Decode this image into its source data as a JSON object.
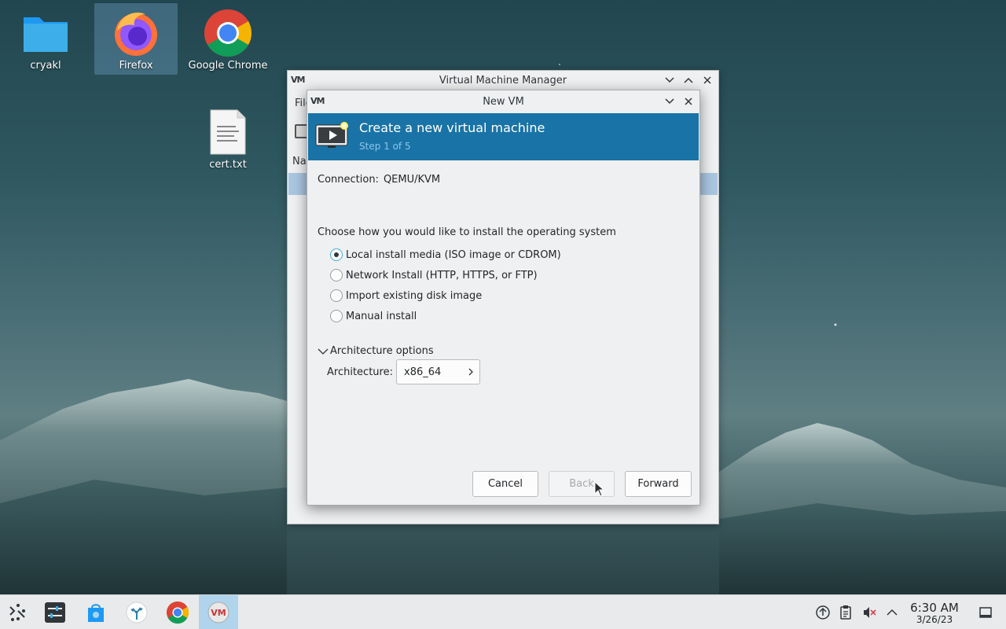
{
  "desktop": {
    "icons": [
      {
        "label": "cryakl"
      },
      {
        "label": "Firefox"
      },
      {
        "label": "Google Chrome"
      },
      {
        "label": "cert.txt"
      }
    ]
  },
  "vmm_window": {
    "logo": "VM",
    "title": "Virtual Machine Manager",
    "menu_partial": "File",
    "column_partial": "Name"
  },
  "dialog": {
    "logo": "VM",
    "title": "New VM",
    "banner_title": "Create a new virtual machine",
    "banner_step": "Step 1 of 5",
    "connection_label": "Connection:",
    "connection_value": "QEMU/KVM",
    "choose_label": "Choose how you would like to install the operating system",
    "options": [
      {
        "label": "Local install media (ISO image or CDROM)",
        "checked": true
      },
      {
        "label": "Network Install (HTTP, HTTPS, or FTP)",
        "checked": false
      },
      {
        "label": "Import existing disk image",
        "checked": false
      },
      {
        "label": "Manual install",
        "checked": false
      }
    ],
    "arch_expander": "Architecture options",
    "arch_label": "Architecture:",
    "arch_value": "x86_64",
    "buttons": {
      "cancel": "Cancel",
      "back": "Back",
      "forward": "Forward"
    }
  },
  "taskbar": {
    "time": "6:30 AM",
    "date": "3/26/23"
  },
  "colors": {
    "banner": "#1a73a6",
    "banner_step_text": "#8ac5ea",
    "selection": "#a9c6e0",
    "taskbar_active": "#b0d4ec"
  }
}
